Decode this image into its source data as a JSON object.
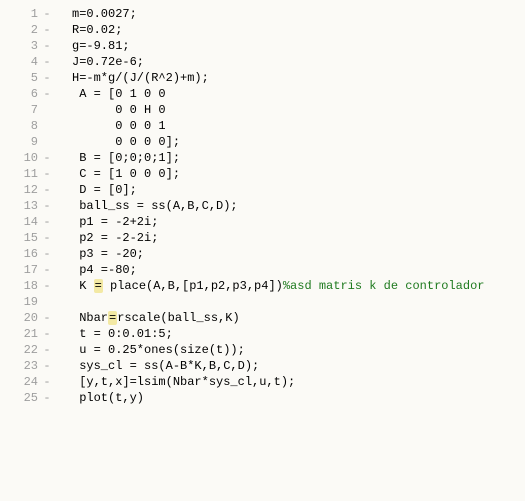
{
  "lines": [
    {
      "n": "1",
      "dash": "-",
      "code": "m=0.0027;"
    },
    {
      "n": "2",
      "dash": "-",
      "code": "R=0.02;"
    },
    {
      "n": "3",
      "dash": "-",
      "code": "g=-9.81;"
    },
    {
      "n": "4",
      "dash": "-",
      "code": "J=0.72e-6;"
    },
    {
      "n": "5",
      "dash": "-",
      "code": "H=-m*g/(J/(R^2)+m);"
    },
    {
      "n": "6",
      "dash": "-",
      "code": " A = [0 1 0 0"
    },
    {
      "n": "7",
      "dash": "",
      "code": "      0 0 H 0"
    },
    {
      "n": "8",
      "dash": "",
      "code": "      0 0 0 1"
    },
    {
      "n": "9",
      "dash": "",
      "code": "      0 0 0 0];"
    },
    {
      "n": "10",
      "dash": "-",
      "code": " B = [0;0;0;1];"
    },
    {
      "n": "11",
      "dash": "-",
      "code": " C = [1 0 0 0];"
    },
    {
      "n": "12",
      "dash": "-",
      "code": " D = [0];"
    },
    {
      "n": "13",
      "dash": "-",
      "code": " ball_ss = ss(A,B,C,D);"
    },
    {
      "n": "14",
      "dash": "-",
      "code": " p1 = -2+2i;"
    },
    {
      "n": "15",
      "dash": "-",
      "code": " p2 = -2-2i;"
    },
    {
      "n": "16",
      "dash": "-",
      "code": " p3 = -20;"
    },
    {
      "n": "17",
      "dash": "-",
      "code": " p4 =-80;"
    },
    {
      "n": "18",
      "dash": "-",
      "pre": " K ",
      " eq": "=",
      "post": " place(A,B,[p1,p2,p3,p4])",
      "comment": "%asd matris k de controlador"
    },
    {
      "n": "19",
      "dash": "",
      "code": ""
    },
    {
      "n": "20",
      "dash": "-",
      "pre2": " Nbar",
      "eq2": "=",
      "post2": "rscale(ball_ss,K)"
    },
    {
      "n": "21",
      "dash": "-",
      "code": " t = 0:0.01:5;"
    },
    {
      "n": "22",
      "dash": "-",
      "code": " u = 0.25*ones(size(t));"
    },
    {
      "n": "23",
      "dash": "-",
      "code": " sys_cl = ss(A-B*K,B,C,D);"
    },
    {
      "n": "24",
      "dash": "-",
      "code": " [y,t,x]=lsim(Nbar*sys_cl,u,t);"
    },
    {
      "n": "25",
      "dash": "-",
      "code": " plot(t,y)"
    }
  ]
}
